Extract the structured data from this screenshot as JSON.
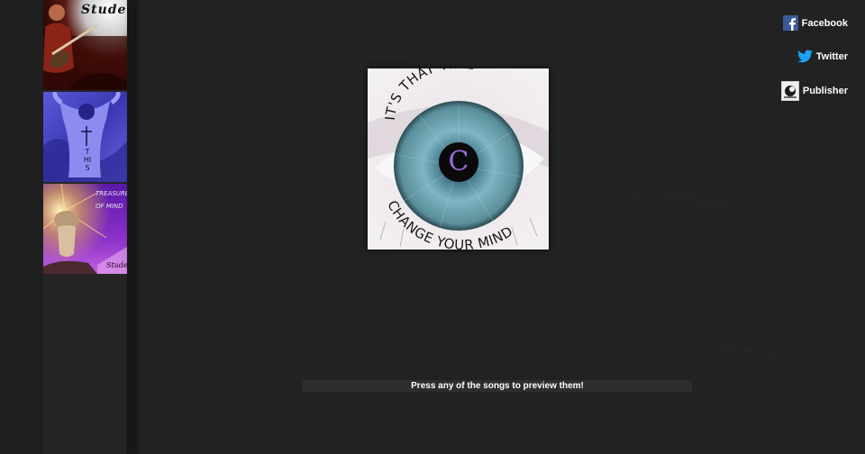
{
  "sidebar": {
    "albums": [
      {
        "title_text": "Studer"
      },
      {
        "title_text": "THIS"
      },
      {
        "title_text": "TREASURE OF MIND",
        "artist_text": "Studer"
      }
    ]
  },
  "main_cover": {
    "top_arc_text": "IT'S THAT TIME",
    "bottom_arc_text": "CHANGE YOUR MIND",
    "center_letter": "C"
  },
  "social": {
    "facebook_label": "Facebook",
    "twitter_label": "Twitter",
    "publisher_label": "Publisher"
  },
  "preview": {
    "hint": "Press any of the songs to preview them!"
  },
  "colors": {
    "background": "#222222",
    "sidebar": "#252525",
    "facebook": "#3b5998",
    "twitter": "#1da1f2",
    "text": "#ffffff"
  }
}
